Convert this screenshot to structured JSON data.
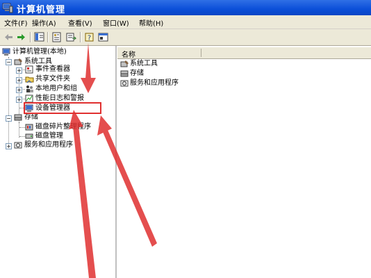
{
  "window": {
    "title": "计算机管理"
  },
  "menubar": [
    {
      "label": "文件(F)"
    },
    {
      "label": "操作(A)"
    },
    {
      "label": "查看(V)"
    },
    {
      "label": "窗口(W)"
    },
    {
      "label": "帮助(H)"
    }
  ],
  "toolbar": {
    "icons": [
      "back-arrow-icon",
      "forward-arrow-icon",
      "show-hide-tree-icon",
      "properties-icon",
      "export-list-icon",
      "help-icon",
      "console-icon"
    ]
  },
  "tree": {
    "root": {
      "label": "计算机管理(本地)"
    },
    "system_tools": {
      "label": "系统工具"
    },
    "event_viewer": {
      "label": "事件查看器"
    },
    "shared_folders": {
      "label": "共享文件夹"
    },
    "local_users": {
      "label": "本地用户和组"
    },
    "perf_logs": {
      "label": "性能日志和警报"
    },
    "device_manager": {
      "label": "设备管理器"
    },
    "storage": {
      "label": "存储"
    },
    "defrag": {
      "label": "磁盘碎片整理程序"
    },
    "disk_mgmt": {
      "label": "磁盘管理"
    },
    "services_apps": {
      "label": "服务和应用程序"
    }
  },
  "right_pane": {
    "column_name": "名称",
    "items": [
      {
        "label": "系统工具"
      },
      {
        "label": "存储"
      },
      {
        "label": "服务和应用程序"
      }
    ]
  },
  "annotation": {
    "color": "#e03030"
  }
}
